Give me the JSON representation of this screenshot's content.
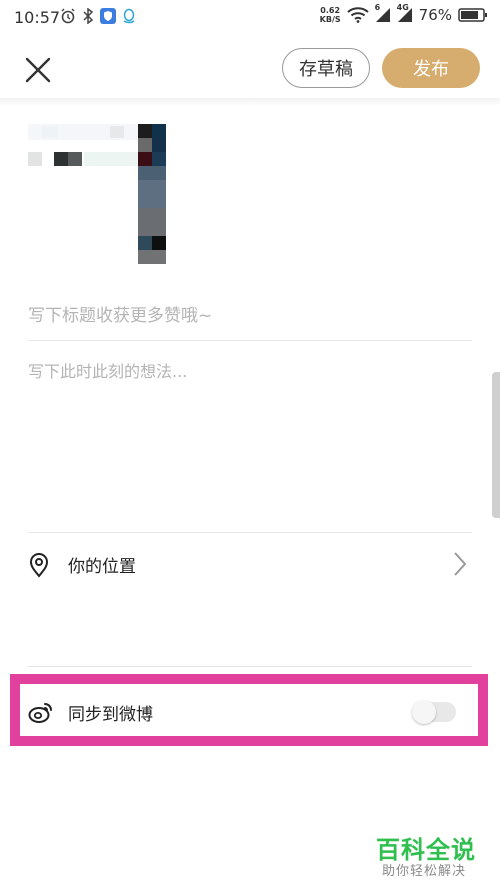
{
  "status_bar": {
    "time": "10:57",
    "network_speed_value": "0.62",
    "network_speed_unit": "KB/S",
    "battery_percent": "76%",
    "signal_1": "6",
    "signal_2": "4G"
  },
  "header": {
    "draft_label": "存草稿",
    "publish_label": "发布",
    "accent_color": "#d6ad6e"
  },
  "editor": {
    "title_placeholder": "写下标题收获更多赞哦~",
    "body_placeholder": "写下此时此刻的想法..."
  },
  "location": {
    "label": "你的位置"
  },
  "weibo_sync": {
    "label": "同步到微博",
    "enabled": false,
    "highlight_color": "#e1409c"
  },
  "watermark": {
    "title": "百科全说",
    "subtitle": "助你轻松解决"
  }
}
